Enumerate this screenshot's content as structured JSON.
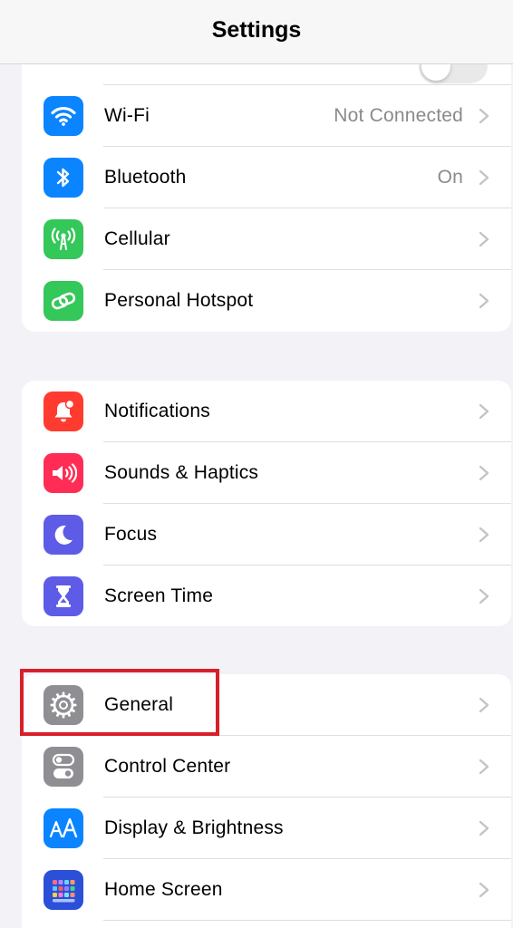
{
  "navbar": {
    "title": "Settings"
  },
  "group1": {
    "partial_row": {
      "icon": "airplane-icon",
      "icon_color": "#ff9500"
    },
    "items": [
      {
        "label": "Wi-Fi",
        "value": "Not Connected",
        "icon": "wifi-icon",
        "icon_color": "#0a84ff"
      },
      {
        "label": "Bluetooth",
        "value": "On",
        "icon": "bluetooth-icon",
        "icon_color": "#0a84ff"
      },
      {
        "label": "Cellular",
        "value": "",
        "icon": "antenna-icon",
        "icon_color": "#34c759"
      },
      {
        "label": "Personal Hotspot",
        "value": "",
        "icon": "link-icon",
        "icon_color": "#34c759"
      }
    ]
  },
  "group2": {
    "items": [
      {
        "label": "Notifications",
        "icon": "bell-icon",
        "icon_color": "#ff3b30"
      },
      {
        "label": "Sounds & Haptics",
        "icon": "speaker-icon",
        "icon_color": "#ff2d55"
      },
      {
        "label": "Focus",
        "icon": "moon-icon",
        "icon_color": "#5e5ce6"
      },
      {
        "label": "Screen Time",
        "icon": "hourglass-icon",
        "icon_color": "#5e5ce6"
      }
    ]
  },
  "group3": {
    "items": [
      {
        "label": "General",
        "icon": "gear-icon",
        "icon_color": "#8e8e93"
      },
      {
        "label": "Control Center",
        "icon": "switches-icon",
        "icon_color": "#8e8e93"
      },
      {
        "label": "Display & Brightness",
        "icon": "text-size-icon",
        "icon_color": "#0a84ff"
      },
      {
        "label": "Home Screen",
        "icon": "app-grid-icon",
        "icon_color": "#2c4fd8"
      }
    ]
  },
  "annotation": {
    "color": "#d8202b"
  }
}
